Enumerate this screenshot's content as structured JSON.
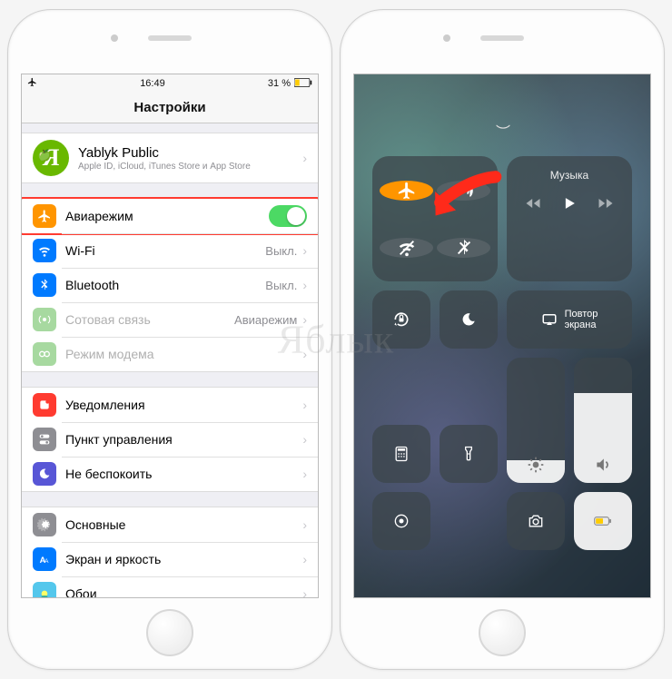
{
  "status": {
    "time": "16:49",
    "battery_pct": "31 %"
  },
  "nav": {
    "title": "Настройки"
  },
  "account": {
    "avatar_letter": "Я",
    "name": "Yablyk Public",
    "subtitle": "Apple ID, iCloud, iTunes Store и App Store"
  },
  "rows": {
    "airplane": "Авиарежим",
    "wifi": "Wi-Fi",
    "wifi_value": "Выкл.",
    "bluetooth": "Bluetooth",
    "bluetooth_value": "Выкл.",
    "cellular": "Сотовая связь",
    "cellular_value": "Авиарежим",
    "hotspot": "Режим модема",
    "notifications": "Уведомления",
    "control_center": "Пункт управления",
    "dnd": "Не беспокоить",
    "general": "Основные",
    "display": "Экран и яркость",
    "wallpaper": "Обои"
  },
  "cc": {
    "music_label": "Музыка",
    "mirror_label": "Повтор\nэкрана"
  },
  "watermark": "Яблык"
}
